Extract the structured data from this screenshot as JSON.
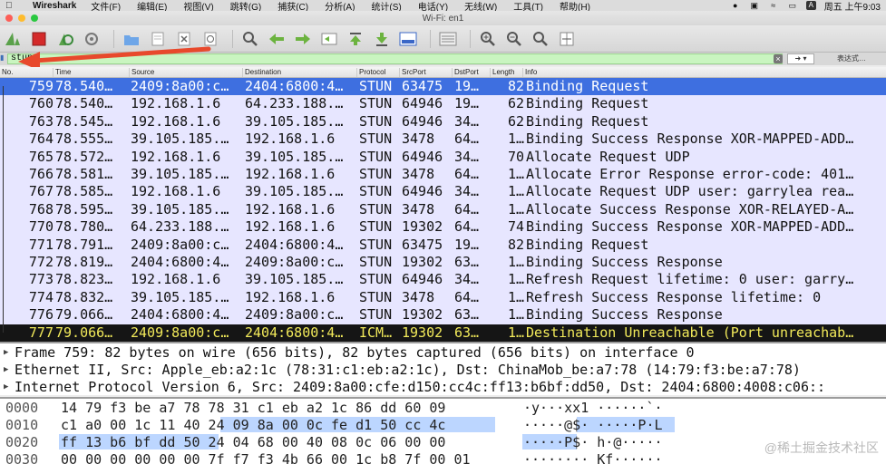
{
  "menubar": {
    "app": "Wireshark",
    "items": [
      "文件(F)",
      "编辑(E)",
      "视图(V)",
      "跳转(G)",
      "捕获(C)",
      "分析(A)",
      "统计(S)",
      "电话(Y)",
      "无线(W)",
      "工具(T)",
      "帮助(H)"
    ],
    "status_a": "A",
    "clock": "周五 上午9:03"
  },
  "window": {
    "title": "Wi-Fi: en1"
  },
  "filter": {
    "value": "stun",
    "expression_label": "表达式…"
  },
  "columns": [
    "No.",
    "Time",
    "Source",
    "Destination",
    "Protocol",
    "SrcPort",
    "DstPort",
    "Length",
    "Info"
  ],
  "packets": [
    {
      "no": "759",
      "time": "78.540…",
      "src": "2409:8a00:c…",
      "dst": "2404:6800:4…",
      "proto": "STUN",
      "sport": "63475",
      "dport": "19…",
      "len": "82",
      "info": "Binding Request",
      "style": "sel"
    },
    {
      "no": "760",
      "time": "78.540…",
      "src": "192.168.1.6",
      "dst": "64.233.188.…",
      "proto": "STUN",
      "sport": "64946",
      "dport": "19…",
      "len": "62",
      "info": "Binding Request",
      "style": ""
    },
    {
      "no": "763",
      "time": "78.545…",
      "src": "192.168.1.6",
      "dst": "39.105.185.…",
      "proto": "STUN",
      "sport": "64946",
      "dport": "34…",
      "len": "62",
      "info": "Binding Request",
      "style": ""
    },
    {
      "no": "764",
      "time": "78.555…",
      "src": "39.105.185.…",
      "dst": "192.168.1.6",
      "proto": "STUN",
      "sport": "3478",
      "dport": "64…",
      "len": "1…",
      "info": "Binding Success Response XOR-MAPPED-ADD…",
      "style": ""
    },
    {
      "no": "765",
      "time": "78.572…",
      "src": "192.168.1.6",
      "dst": "39.105.185.…",
      "proto": "STUN",
      "sport": "64946",
      "dport": "34…",
      "len": "70",
      "info": "Allocate Request UDP",
      "style": ""
    },
    {
      "no": "766",
      "time": "78.581…",
      "src": "39.105.185.…",
      "dst": "192.168.1.6",
      "proto": "STUN",
      "sport": "3478",
      "dport": "64…",
      "len": "1…",
      "info": "Allocate Error Response error-code: 401…",
      "style": ""
    },
    {
      "no": "767",
      "time": "78.585…",
      "src": "192.168.1.6",
      "dst": "39.105.185.…",
      "proto": "STUN",
      "sport": "64946",
      "dport": "34…",
      "len": "1…",
      "info": "Allocate Request UDP user: garrylea rea…",
      "style": ""
    },
    {
      "no": "768",
      "time": "78.595…",
      "src": "39.105.185.…",
      "dst": "192.168.1.6",
      "proto": "STUN",
      "sport": "3478",
      "dport": "64…",
      "len": "1…",
      "info": "Allocate Success Response XOR-RELAYED-A…",
      "style": ""
    },
    {
      "no": "770",
      "time": "78.780…",
      "src": "64.233.188.…",
      "dst": "192.168.1.6",
      "proto": "STUN",
      "sport": "19302",
      "dport": "64…",
      "len": "74",
      "info": "Binding Success Response XOR-MAPPED-ADD…",
      "style": ""
    },
    {
      "no": "771",
      "time": "78.791…",
      "src": "2409:8a00:c…",
      "dst": "2404:6800:4…",
      "proto": "STUN",
      "sport": "63475",
      "dport": "19…",
      "len": "82",
      "info": "Binding Request",
      "style": ""
    },
    {
      "no": "772",
      "time": "78.819…",
      "src": "2404:6800:4…",
      "dst": "2409:8a00:c…",
      "proto": "STUN",
      "sport": "19302",
      "dport": "63…",
      "len": "1…",
      "info": "Binding Success Response",
      "style": ""
    },
    {
      "no": "773",
      "time": "78.823…",
      "src": "192.168.1.6",
      "dst": "39.105.185.…",
      "proto": "STUN",
      "sport": "64946",
      "dport": "34…",
      "len": "1…",
      "info": "Refresh Request lifetime: 0 user: garry…",
      "style": ""
    },
    {
      "no": "774",
      "time": "78.832…",
      "src": "39.105.185.…",
      "dst": "192.168.1.6",
      "proto": "STUN",
      "sport": "3478",
      "dport": "64…",
      "len": "1…",
      "info": "Refresh Success Response lifetime: 0",
      "style": ""
    },
    {
      "no": "776",
      "time": "79.066…",
      "src": "2404:6800:4…",
      "dst": "2409:8a00:c…",
      "proto": "STUN",
      "sport": "19302",
      "dport": "63…",
      "len": "1…",
      "info": "Binding Success Response",
      "style": ""
    },
    {
      "no": "777",
      "time": "79.066…",
      "src": "2409:8a00:c…",
      "dst": "2404:6800:4…",
      "proto": "ICM…",
      "sport": "19302",
      "dport": "63…",
      "len": "1…",
      "info": "Destination Unreachable (Port unreachab…",
      "style": "err"
    }
  ],
  "details": [
    "Frame 759: 82 bytes on wire (656 bits), 82 bytes captured (656 bits) on interface 0",
    "Ethernet II, Src: Apple_eb:a2:1c (78:31:c1:eb:a2:1c), Dst: ChinaMob_be:a7:78 (14:79:f3:be:a7:78)",
    "Internet Protocol Version 6, Src: 2409:8a00:cfe:d150:cc4c:ff13:b6bf:dd50, Dst: 2404:6800:4008:c06::"
  ],
  "hex_rows": [
    {
      "off": "0000",
      "hex": "14 79 f3 be a7 78 78 31  c1 eb a2 1c 86 dd 60 09",
      "ascii": "·y···xx1 ······`·"
    },
    {
      "off": "0010",
      "hex": "c1 a0 00 1c 11 40 24 09  8a 00 0c fe d1 50 cc 4c",
      "ascii": "·····@$· ·····P·L"
    },
    {
      "off": "0020",
      "hex": "ff 13 b6 bf dd 50 24 04  68 00 40 08 0c 06 00 00",
      "ascii": "·····P$· h·@·····"
    },
    {
      "off": "0030",
      "hex": "00 00 00 00 00 00 7f f7 f3  4b 66 00 1c b8 7f 00 01",
      "ascii": "········ Kf······"
    }
  ],
  "watermark": "@稀土掘金技术社区",
  "colors": {
    "selected_row": "#3e6fe0",
    "error_row_bg": "#151515",
    "error_row_fg": "#f2ea5a",
    "list_bg": "#e7e6ff",
    "filter_ok": "#c9f5c0",
    "annotation_arrow": "#e8492c"
  }
}
